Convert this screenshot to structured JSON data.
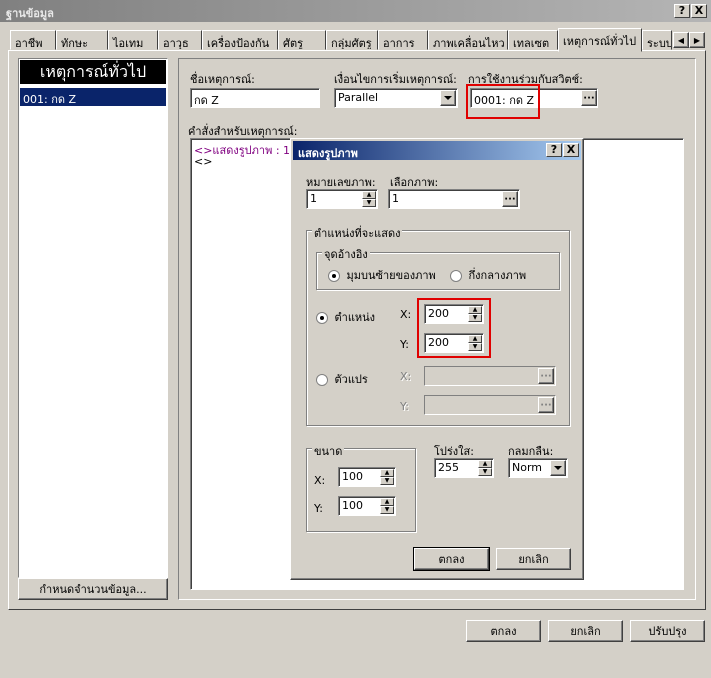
{
  "window": {
    "title": "ฐานข้อมูล",
    "help_btn": "?",
    "close_btn": "X"
  },
  "tabs": [
    {
      "label": "อาชีพ"
    },
    {
      "label": "ทักษะ"
    },
    {
      "label": "ไอเทม"
    },
    {
      "label": "อาวุธ"
    },
    {
      "label": "เครื่องป้องกัน"
    },
    {
      "label": "ศัตรู"
    },
    {
      "label": "กลุ่มศัตรู"
    },
    {
      "label": "อาการ"
    },
    {
      "label": "ภาพเคลื่อนไหว"
    },
    {
      "label": "เทลเซต"
    },
    {
      "label": "เหตุการณ์ทั่วไป"
    },
    {
      "label": "ระบบ"
    }
  ],
  "left_panel": {
    "header": "เหตุการณ์ทั่วไป",
    "items": [
      "001: กด Z"
    ],
    "max_button": "กำหนดจำนวนข้อมูล..."
  },
  "event": {
    "name_label": "ชื่อเหตุการณ์:",
    "name_value": "กด Z",
    "trigger_label": "เงื่อนไขการเริ่มเหตุการณ์:",
    "trigger_value": "Parallel",
    "switch_label": "การใช้งานร่วมกับสวิตช์:",
    "switch_value": "0001: กด Z",
    "commands_label": "คำสั่งสำหรับเหตุการณ์:",
    "commands": [
      "<>แสดงรูปภาพ : 1, '",
      "<>"
    ]
  },
  "footer": {
    "ok": "ตกลง",
    "cancel": "ยกเลิก",
    "apply": "ปรับปรุง"
  },
  "dialog": {
    "title": "แสดงรูปภาพ",
    "help_btn": "?",
    "close_btn": "X",
    "number_label": "หมายเลขภาพ:",
    "number_value": "1",
    "picture_label": "เลือกภาพ:",
    "picture_value": "1",
    "position_group": "ตำแหน่งที่จะแสดง",
    "origin_group": "จุดอ้างอิง",
    "origin_topleft": "มุมบนซ้ายของภาพ",
    "origin_center": "กึ่งกลางภาพ",
    "direct_label": "ตำแหน่ง",
    "variable_label": "ตัวแปร",
    "x_label": "X:",
    "y_label": "Y:",
    "x_value": "200",
    "y_value": "200",
    "zoom_group": "ขนาด",
    "zoom_x": "100",
    "zoom_y": "100",
    "opacity_label": "โปร่งใส:",
    "opacity_value": "255",
    "blend_label": "กลมกลืน:",
    "blend_value": "Norm",
    "ok": "ตกลง",
    "cancel": "ยกเลิก"
  },
  "colors": {
    "highlight": "#e00000",
    "dialog_title": "#0a246a",
    "command_text": "#800080"
  }
}
